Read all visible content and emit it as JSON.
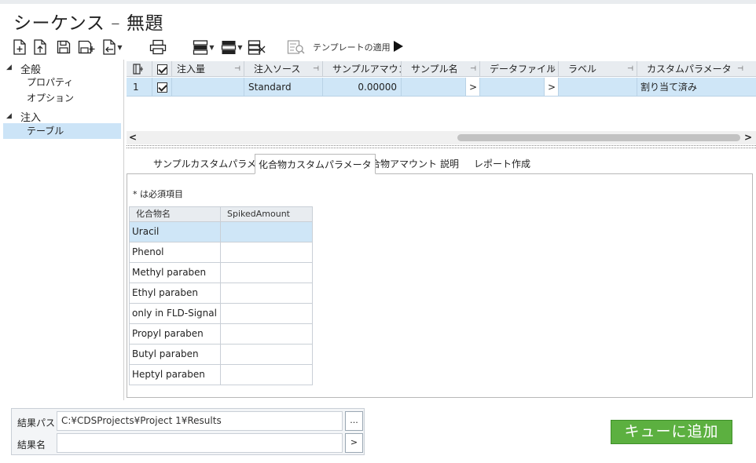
{
  "window": {
    "title": "シーケンス – 無題"
  },
  "toolbar": {
    "apply_template_label": "テンプレートの適用",
    "icons": [
      "new-file-icon",
      "import-icon",
      "save-icon",
      "save-as-icon",
      "export-icon",
      "print-icon",
      "insert-row-icon",
      "delete-row-icon",
      "clear-rows-icon",
      "template-icon",
      "play-icon"
    ]
  },
  "tree": {
    "general": {
      "label": "全般",
      "children": [
        "プロパティ",
        "オプション"
      ]
    },
    "injection": {
      "label": "注入",
      "children": [
        "テーブル"
      ]
    }
  },
  "grid": {
    "columns": [
      "注入量",
      "注入ソース",
      "サンプルアマウン",
      "サンプル名",
      "データファイル",
      "ラベル",
      "カスタムパラメータ"
    ],
    "rows": [
      {
        "index": "1",
        "checked": true,
        "injection_volume": "",
        "injection_source": "Standard",
        "sample_amount": "0.00000",
        "sample_name": "",
        "sample_name_btn": ">",
        "data_file": "",
        "data_file_btn": ">",
        "label": "",
        "custom_params": "割り当て済み"
      }
    ]
  },
  "scroll": {
    "left": "<",
    "right": ">"
  },
  "tabs": [
    "サンプルカスタムパラメータ",
    "化合物カスタムパラメータ",
    "化合物アマウント",
    "説明",
    "レポート作成"
  ],
  "active_tab": "化合物カスタムパラメータ",
  "panel": {
    "required_note": "* は必須項目",
    "columns": [
      "化合物名",
      "SpikedAmount"
    ],
    "compounds": [
      {
        "name": "Uracil",
        "spiked": ""
      },
      {
        "name": "Phenol",
        "spiked": ""
      },
      {
        "name": "Methyl paraben",
        "spiked": ""
      },
      {
        "name": "Ethyl paraben",
        "spiked": ""
      },
      {
        "name": "only in FLD-Signal",
        "spiked": ""
      },
      {
        "name": "Propyl paraben",
        "spiked": ""
      },
      {
        "name": "Butyl paraben",
        "spiked": ""
      },
      {
        "name": "Heptyl paraben",
        "spiked": ""
      }
    ]
  },
  "results": {
    "path_label": "結果パス",
    "path_value": "C:¥CDSProjects¥Project 1¥Results",
    "path_btn": "...",
    "name_label": "結果名",
    "name_value": "",
    "name_btn": ">"
  },
  "add_to_queue": "キューに追加",
  "colors": {
    "accent_green": "#5cb040",
    "selection_blue": "#cfe6f7"
  }
}
